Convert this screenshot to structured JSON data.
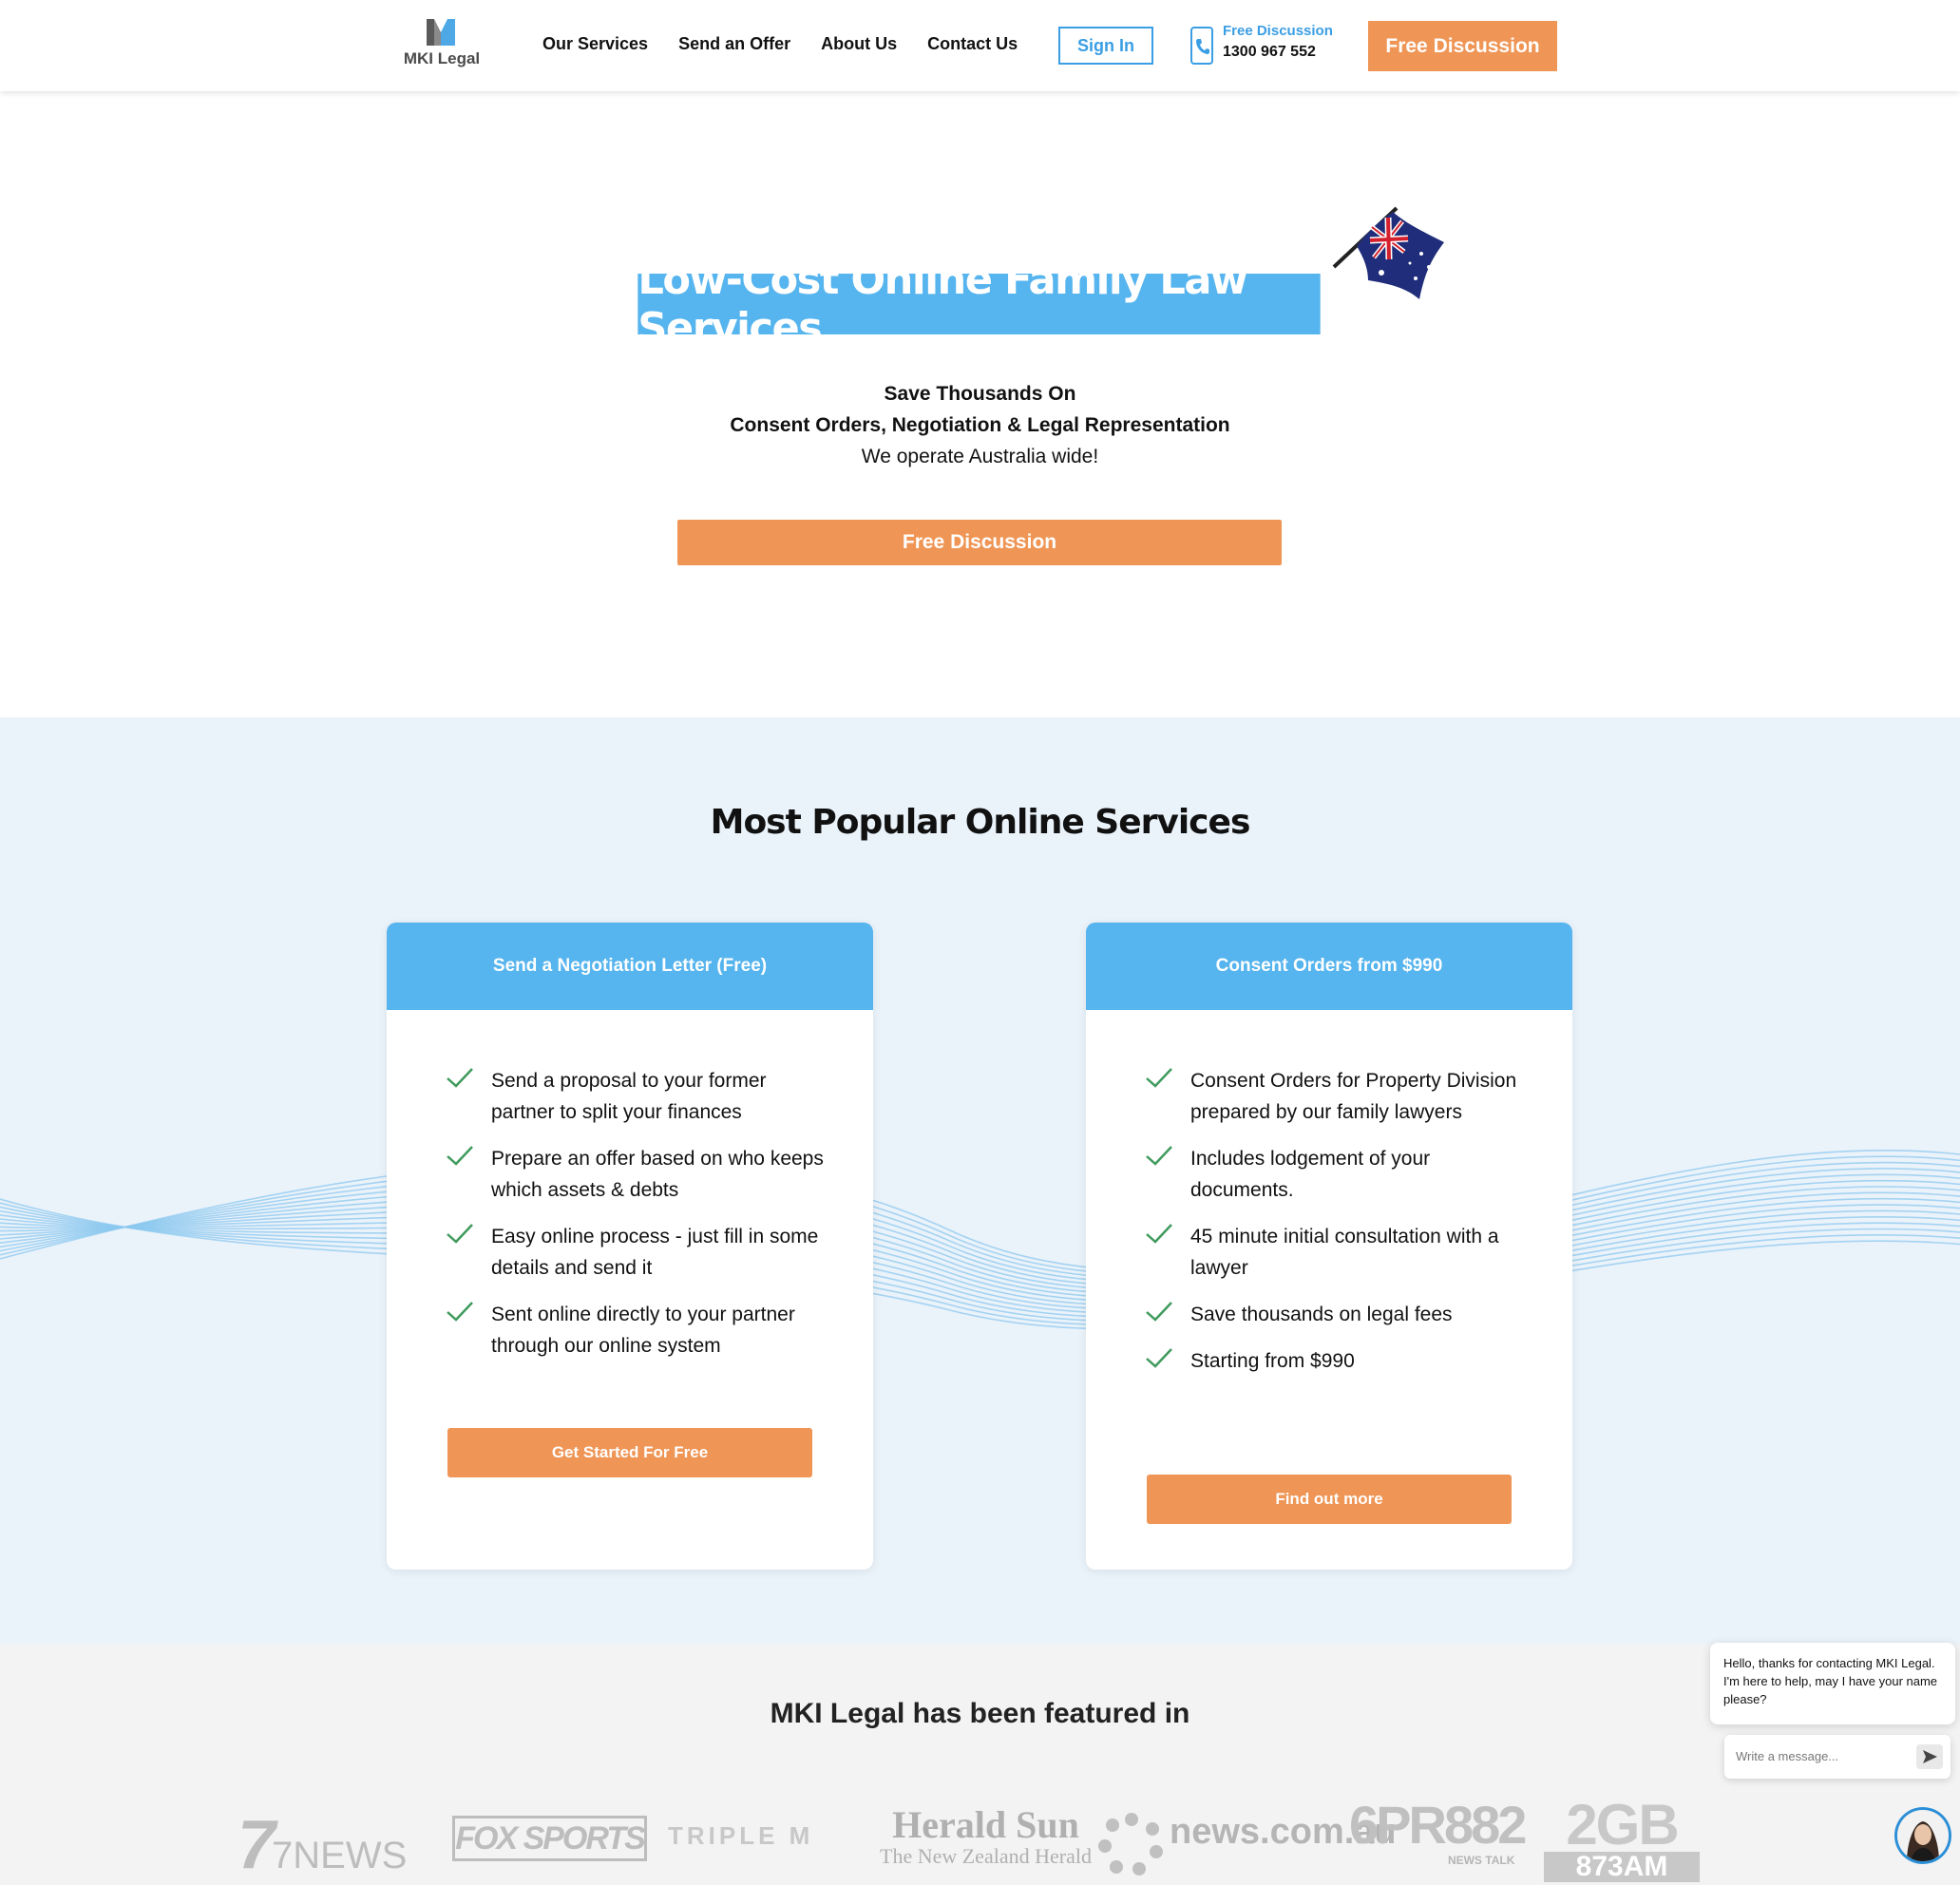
{
  "header": {
    "logo_text": "MKI Legal",
    "nav": [
      "Our Services",
      "Send an Offer",
      "About Us",
      "Contact Us"
    ],
    "signin_label": "Sign In",
    "phone_label": "Free Discussion",
    "phone_number": "1300 967 552",
    "cta_label": "Free Discussion"
  },
  "hero": {
    "title": "Low-Cost Online Family Law Services",
    "line1": "Save Thousands On",
    "line2": "Consent Orders, Negotiation & Legal Representation",
    "line3": "We operate Australia wide!",
    "cta_label": "Free Discussion"
  },
  "services": {
    "title": "Most Popular Online Services",
    "cards": [
      {
        "heading": "Send a Negotiation Letter (Free)",
        "items": [
          "Send a proposal to your former partner to split your finances",
          "Prepare an offer based on who keeps which assets & debts",
          "Easy online process - just fill in some details and send it",
          "Sent online directly to your partner through our online system"
        ],
        "button": "Get Started For Free"
      },
      {
        "heading": "Consent Orders from $990",
        "items": [
          "Consent Orders for Property Division prepared by our family lawyers",
          "Includes lodgement of your documents.",
          "45 minute initial consultation with a lawyer",
          "Save thousands on legal fees",
          "Starting from $990"
        ],
        "button": "Find out more"
      }
    ]
  },
  "featured": {
    "title": "MKI Legal has been featured in",
    "outlets": [
      "7NEWS",
      "FOX SPORTS",
      "TRIPLE M",
      "Herald Sun",
      "The New Zealand Herald",
      "news.com.au",
      "6PR882",
      "NEWS TALK",
      "2GB",
      "873AM"
    ]
  },
  "chat": {
    "message": "Hello, thanks for contacting MKI Legal. I'm here to help, may I have your name please?",
    "input_placeholder": "Write a message..."
  },
  "colors": {
    "accent_blue": "#56b4ee",
    "cta_orange": "#ef9555",
    "check_green": "#3f9a5c",
    "services_bg": "#eaf2fa"
  }
}
